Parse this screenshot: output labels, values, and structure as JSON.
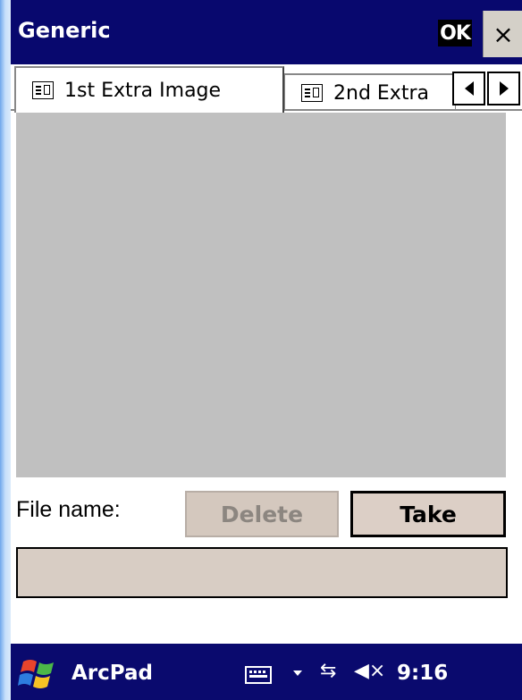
{
  "window": {
    "title": "Generic",
    "ok_label": "OK",
    "close_label": "×"
  },
  "tabs": [
    {
      "label": "1st Extra Image",
      "icon": "form-icon",
      "selected": true
    },
    {
      "label": "2nd Extra",
      "icon": "form-icon",
      "selected": false
    }
  ],
  "form": {
    "file_label": "File name:",
    "delete_label": "Delete",
    "delete_enabled": false,
    "take_label": "Take",
    "filename_value": ""
  },
  "taskbar": {
    "app_name": "ArcPad",
    "time": "9:16",
    "connectivity_glyph": "⇆",
    "volume_glyph": "◀×"
  },
  "colors": {
    "titlebar": "#08086e",
    "image_area": "#c0c0c0",
    "button_face": "#dccfc6"
  }
}
